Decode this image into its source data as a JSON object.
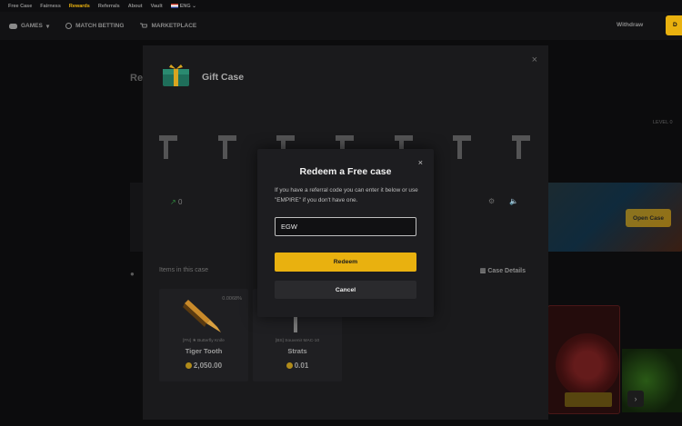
{
  "top_links": [
    {
      "label": "Free Case",
      "active": false
    },
    {
      "label": "Fairness",
      "active": false
    },
    {
      "label": "Rewards",
      "active": true
    },
    {
      "label": "Referrals",
      "active": false
    },
    {
      "label": "About",
      "active": false
    },
    {
      "label": "Vault",
      "active": false
    }
  ],
  "language": "ENG",
  "nav": {
    "games": "GAMES",
    "match_betting": "MATCH BETTING",
    "marketplace": "MARKETPLACE",
    "withdraw": "Withdraw",
    "deposit": "D"
  },
  "background": {
    "title": "Re",
    "level": "LEVEL",
    "level_value": "0",
    "open_case": "Open Case"
  },
  "case_panel": {
    "title": "Gift Case",
    "close": "×",
    "balance": "0",
    "items_label": "Items in this case",
    "case_details": "Case Details",
    "items": [
      {
        "chance": "0.0068%",
        "weapon": "[FN] ★ Butterfly Knife",
        "name": "Tiger Tooth",
        "price": "2,050.00"
      },
      {
        "chance": "",
        "weapon": "[BS] Souvenir MAC-10",
        "name": "Strats",
        "price": "0.01"
      }
    ]
  },
  "modal": {
    "title": "Redeem a Free case",
    "close": "×",
    "description": "If you have a referral code you can enter it below or use \"EMPIRE\" if you don't have one.",
    "input_value": "EGW",
    "redeem": "Redeem",
    "cancel": "Cancel"
  },
  "colors": {
    "accent": "#e9b10f",
    "background": "#0c0c0d",
    "modal": "#1d1d20"
  }
}
